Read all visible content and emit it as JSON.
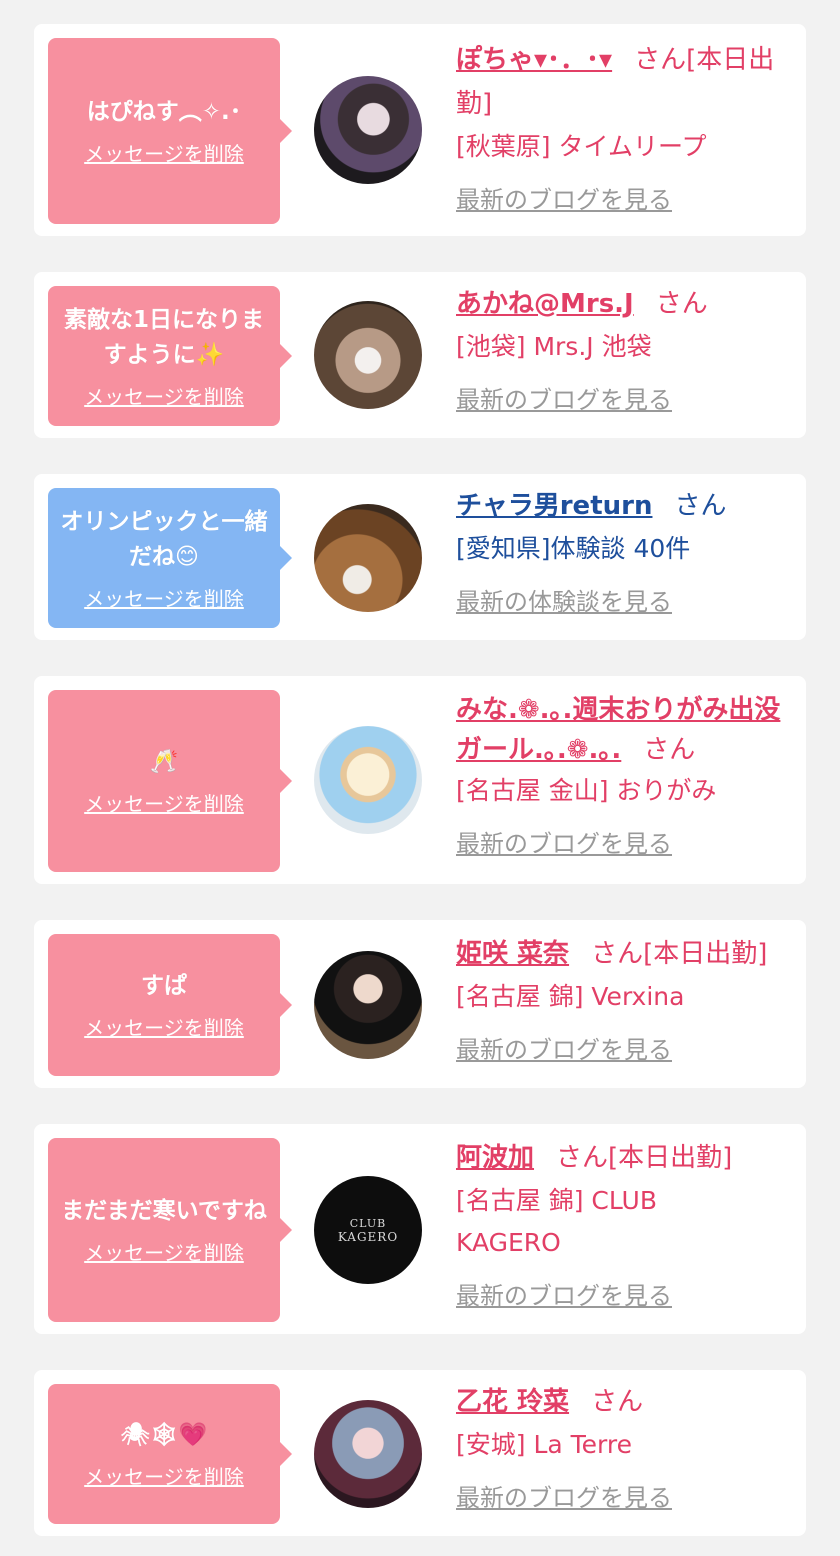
{
  "cards": [
    {
      "message": "はぴねす︵✧.･",
      "delete_label": "メッセージを削除",
      "name": "ぽちゃ▾･．･▾",
      "san": "さん[本日出勤]",
      "shop": "[秋葉原] タイムリープ",
      "blog_label": "最新のブログを見る"
    },
    {
      "message": "素敵な1日になりますように✨",
      "delete_label": "メッセージを削除",
      "name": "あかね@Mrs.J",
      "san": "さん",
      "shop": "[池袋] Mrs.J 池袋",
      "blog_label": "最新のブログを見る"
    },
    {
      "message": "オリンピックと一緒だね😊",
      "delete_label": "メッセージを削除",
      "name": "チャラ男return",
      "san": "さん",
      "shop": "[愛知県]体験談 40件",
      "blog_label": "最新の体験談を見る"
    },
    {
      "message": "🥂",
      "delete_label": "メッセージを削除",
      "name": "みな.❁.｡.週末おりがみ出没ガール.｡.❁.｡.",
      "san": "さん",
      "shop": "[名古屋 金山] おりがみ",
      "blog_label": "最新のブログを見る"
    },
    {
      "message": "すぱ",
      "delete_label": "メッセージを削除",
      "name": "姫咲 菜奈",
      "san": "さん[本日出勤]",
      "shop": "[名古屋 錦] Verxina",
      "blog_label": "最新のブログを見る"
    },
    {
      "message": "まだまだ寒いですね",
      "delete_label": "メッセージを削除",
      "name": "阿波加",
      "san": "さん[本日出勤]",
      "shop": "[名古屋 錦] CLUB KAGERO",
      "blog_label": "最新のブログを見る",
      "avatar_text_1": "CLUB",
      "avatar_text_2": "KAGERO"
    },
    {
      "message": "🕷🕸💗",
      "delete_label": "メッセージを削除",
      "name": "乙花 玲菜",
      "san": "さん",
      "shop": "[安城] La Terre",
      "blog_label": "最新のブログを見る"
    }
  ],
  "colors": {
    "pink_bubble": "#f7909f",
    "blue_bubble": "#84b6f3",
    "pink_text": "#e23f66",
    "blue_text": "#1e4f9c"
  }
}
